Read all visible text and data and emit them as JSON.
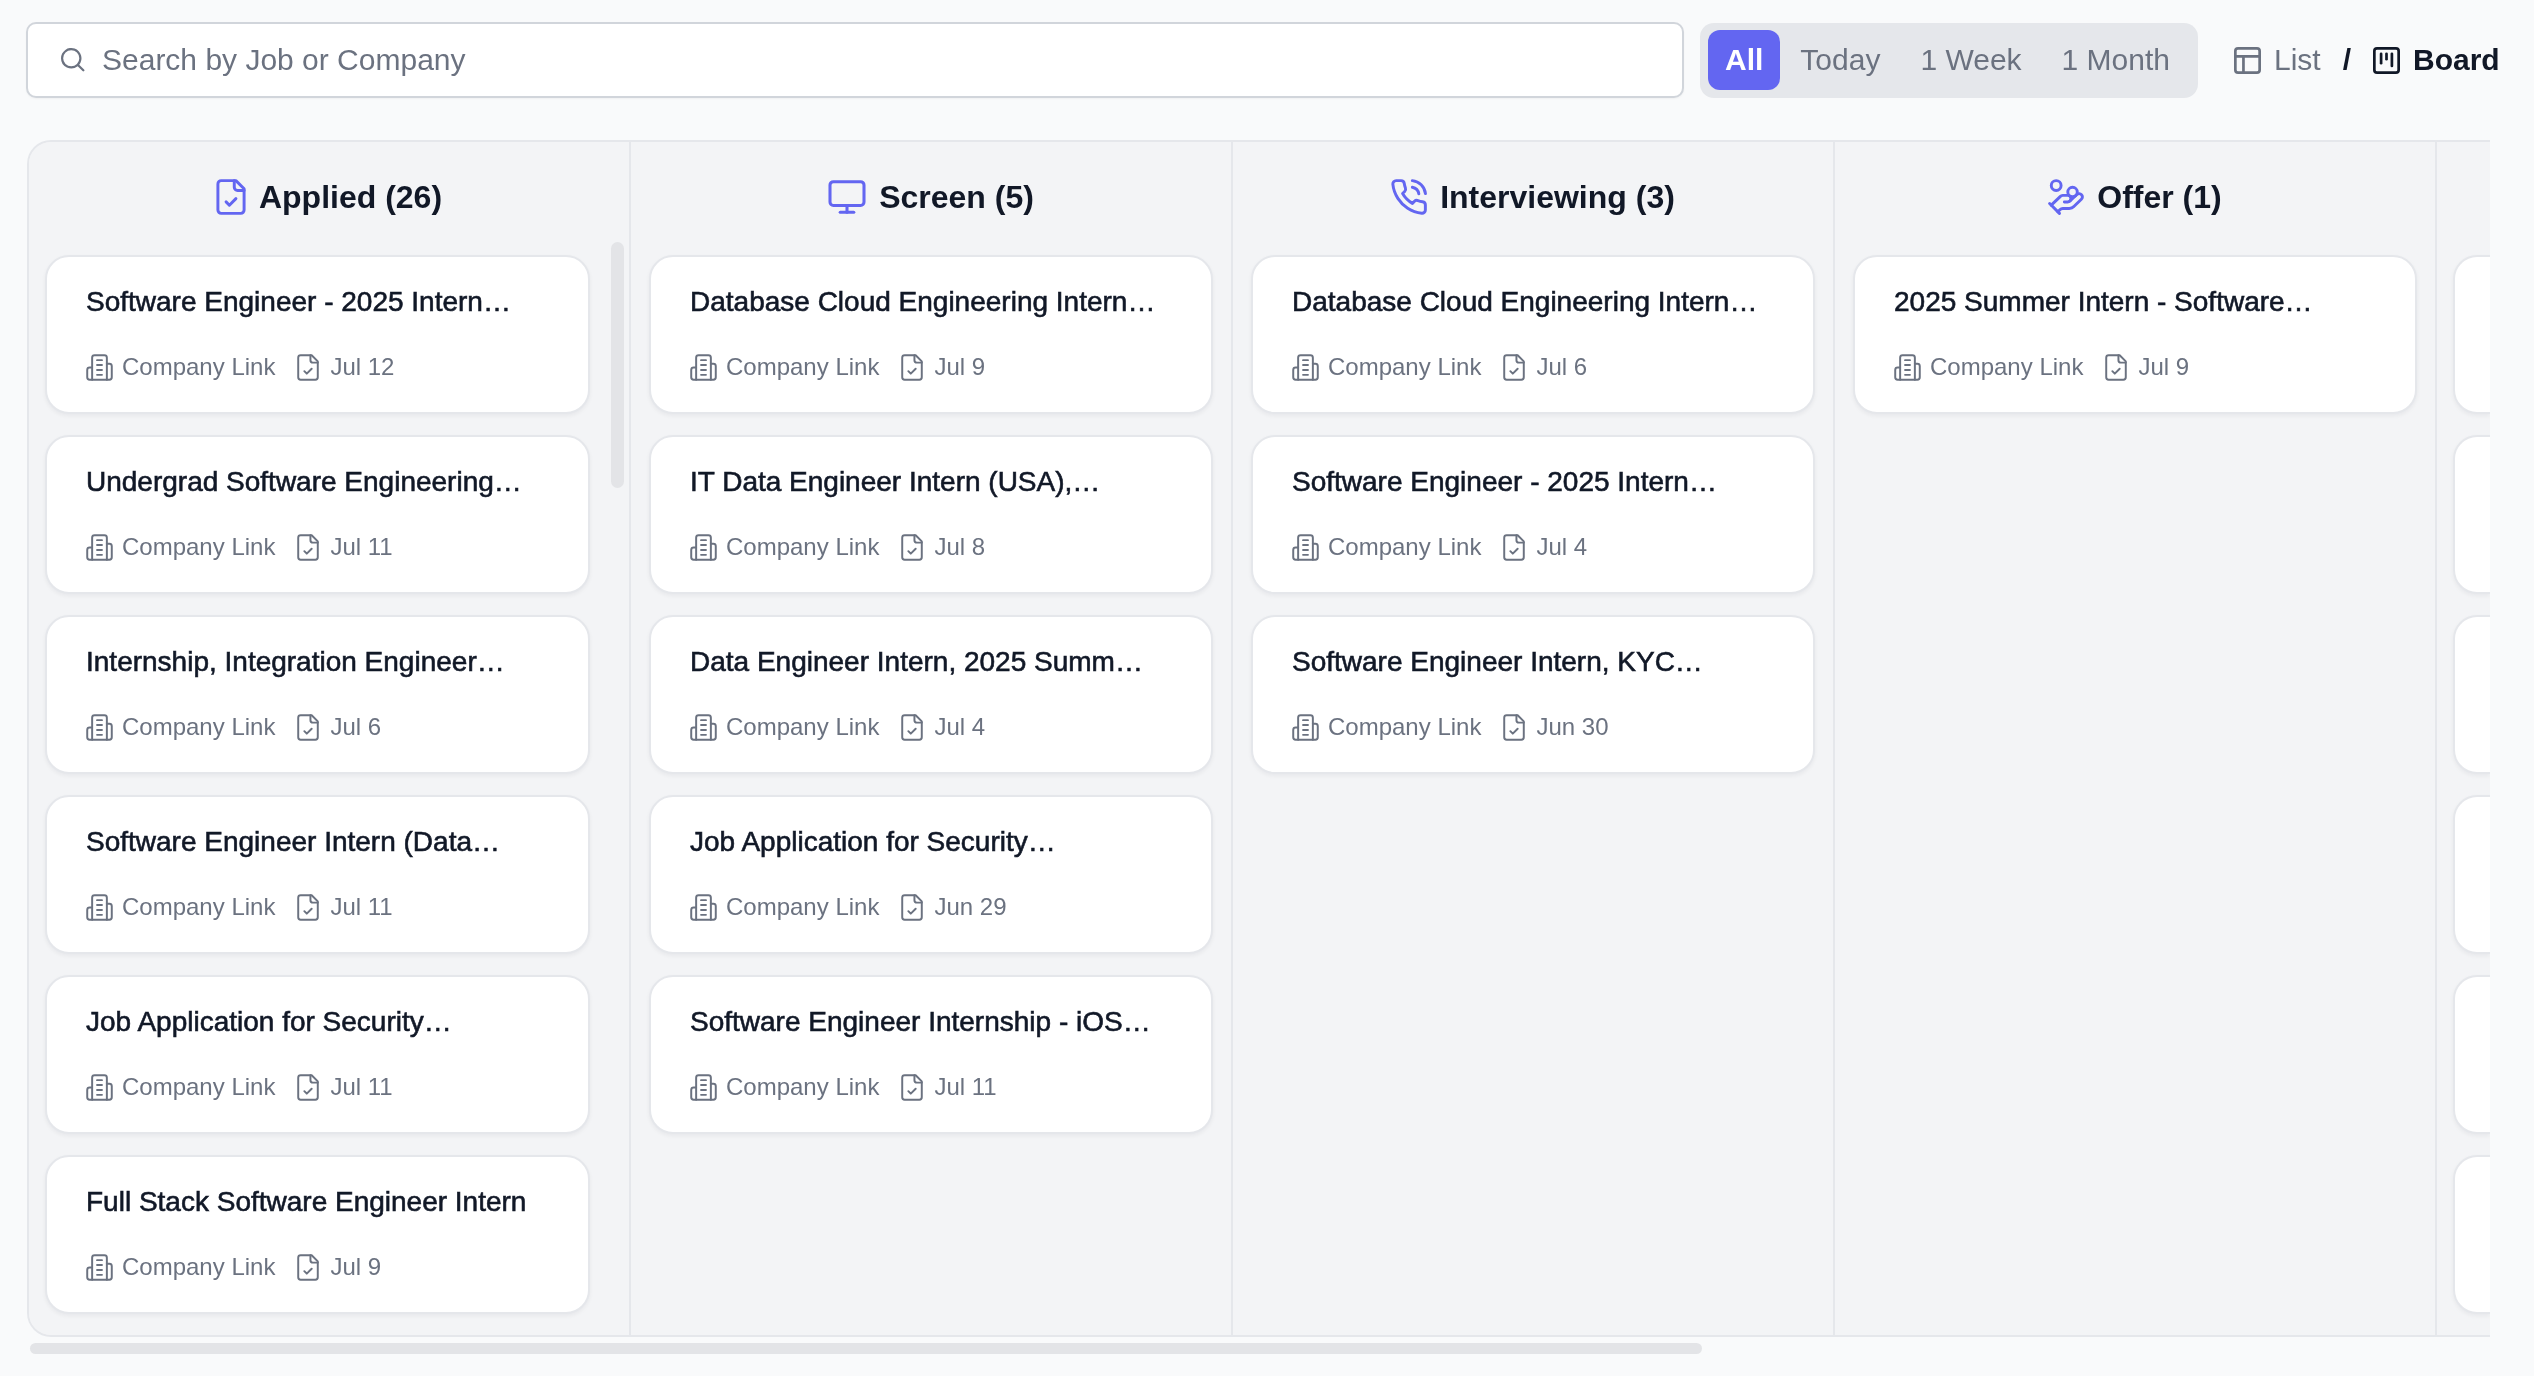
{
  "search": {
    "placeholder": "Search by Job or Company"
  },
  "filters": [
    {
      "label": "All",
      "selected": true
    },
    {
      "label": "Today",
      "selected": false
    },
    {
      "label": "1 Week",
      "selected": false
    },
    {
      "label": "1 Month",
      "selected": false
    }
  ],
  "view_toggle": {
    "options": [
      {
        "label": "List",
        "kind": "list",
        "selected": false
      },
      {
        "label": "Board",
        "kind": "board",
        "selected": true
      }
    ],
    "separator": "/"
  },
  "columns": [
    {
      "title": "Applied (26)",
      "kind": "applied",
      "scrollable": true,
      "cards": [
        {
          "title": "Software Engineer - 2025 Intern…",
          "link": "Company Link",
          "date": "Jul 12"
        },
        {
          "title": "Undergrad Software Engineering…",
          "link": "Company Link",
          "date": "Jul 11"
        },
        {
          "title": "Internship, Integration Engineer…",
          "link": "Company Link",
          "date": "Jul 6"
        },
        {
          "title": "Software Engineer Intern (Data…",
          "link": "Company Link",
          "date": "Jul 11"
        },
        {
          "title": "Job Application for Security…",
          "link": "Company Link",
          "date": "Jul 11"
        },
        {
          "title": "Full Stack Software Engineer Intern",
          "link": "Company Link",
          "date": "Jul 9"
        }
      ]
    },
    {
      "title": "Screen (5)",
      "kind": "screen",
      "scrollable": false,
      "cards": [
        {
          "title": "Database Cloud Engineering Intern…",
          "link": "Company Link",
          "date": "Jul 9"
        },
        {
          "title": "IT Data Engineer Intern (USA),…",
          "link": "Company Link",
          "date": "Jul 8"
        },
        {
          "title": "Data Engineer Intern, 2025 Summ…",
          "link": "Company Link",
          "date": "Jul 4"
        },
        {
          "title": "Job Application for Security…",
          "link": "Company Link",
          "date": "Jun 29"
        },
        {
          "title": "Software Engineer Internship - iOS…",
          "link": "Company Link",
          "date": "Jul 11"
        }
      ]
    },
    {
      "title": "Interviewing (3)",
      "kind": "interviewing",
      "scrollable": false,
      "cards": [
        {
          "title": "Database Cloud Engineering Intern…",
          "link": "Company Link",
          "date": "Jul 6"
        },
        {
          "title": "Software Engineer - 2025 Intern…",
          "link": "Company Link",
          "date": "Jul 4"
        },
        {
          "title": "Software Engineer Intern, KYC…",
          "link": "Company Link",
          "date": "Jun 30"
        }
      ]
    },
    {
      "title": "Offer (1)",
      "kind": "offer",
      "scrollable": false,
      "cards": [
        {
          "title": "2025 Summer Intern - Software…",
          "link": "Company Link",
          "date": "Jul 9"
        }
      ]
    }
  ]
}
